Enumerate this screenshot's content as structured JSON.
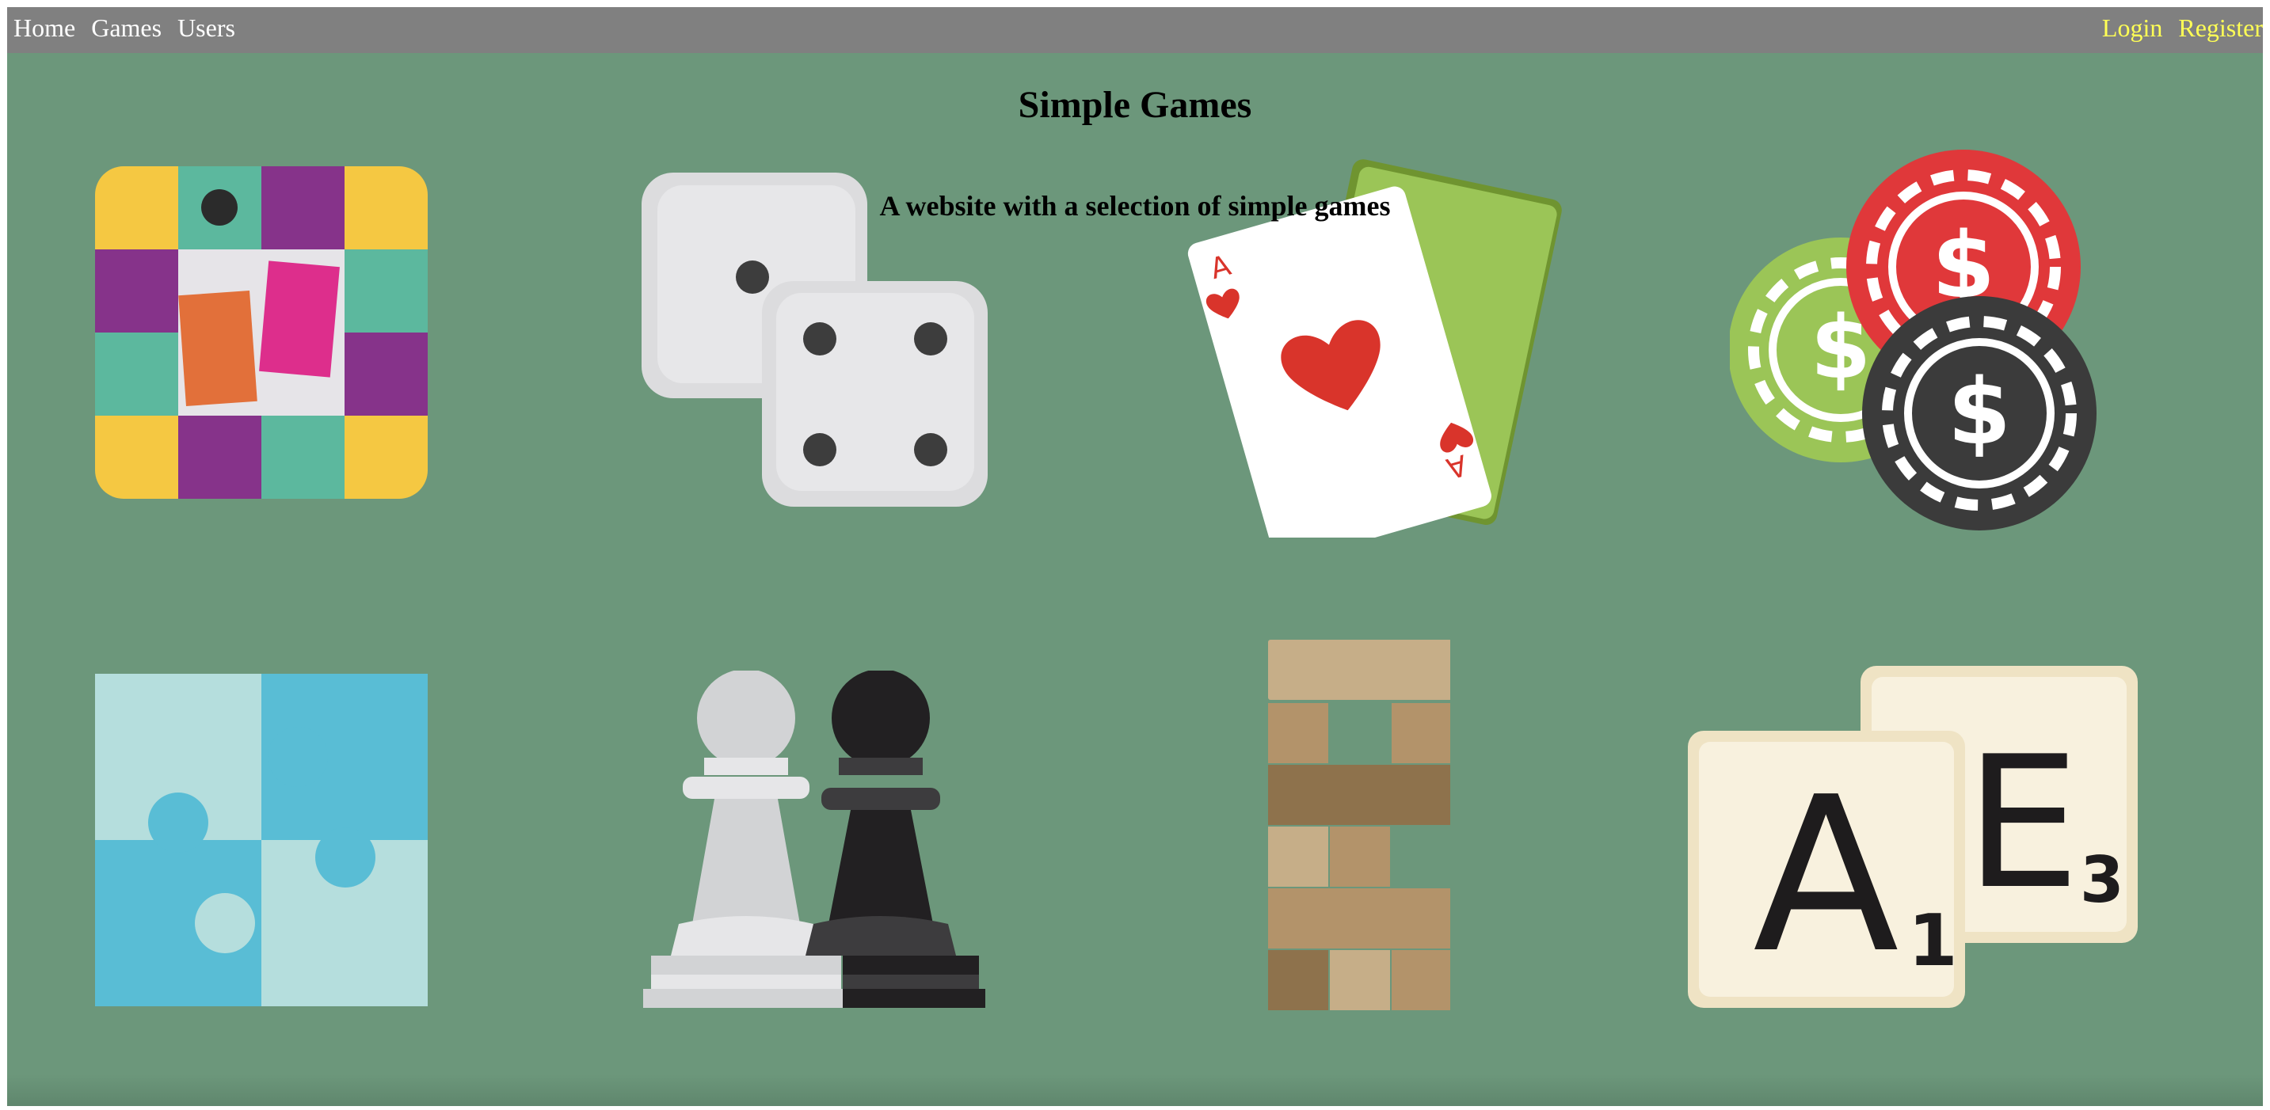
{
  "nav": {
    "left": [
      {
        "label": "Home"
      },
      {
        "label": "Games"
      },
      {
        "label": "Users"
      }
    ],
    "right": [
      {
        "label": "Login"
      },
      {
        "label": "Register"
      }
    ]
  },
  "hero": {
    "title": "Simple Games",
    "subtitle": "A website with a selection of simple games"
  },
  "colors": {
    "background": "#6c977b",
    "navbar": "#808080",
    "nav_text": "#ffffff",
    "auth_text": "#ffff55"
  },
  "games": [
    {
      "icon": "board-game-icon"
    },
    {
      "icon": "dice-icon"
    },
    {
      "icon": "playing-cards-icon",
      "card_rank": "A"
    },
    {
      "icon": "casino-chips-icon",
      "chip_symbol": "$"
    },
    {
      "icon": "jigsaw-puzzle-icon"
    },
    {
      "icon": "chess-pawns-icon"
    },
    {
      "icon": "jenga-tower-icon"
    },
    {
      "icon": "letter-tiles-icon",
      "tiles": [
        {
          "letter": "A",
          "score": "1"
        },
        {
          "letter": "E",
          "score": "3"
        }
      ]
    }
  ]
}
